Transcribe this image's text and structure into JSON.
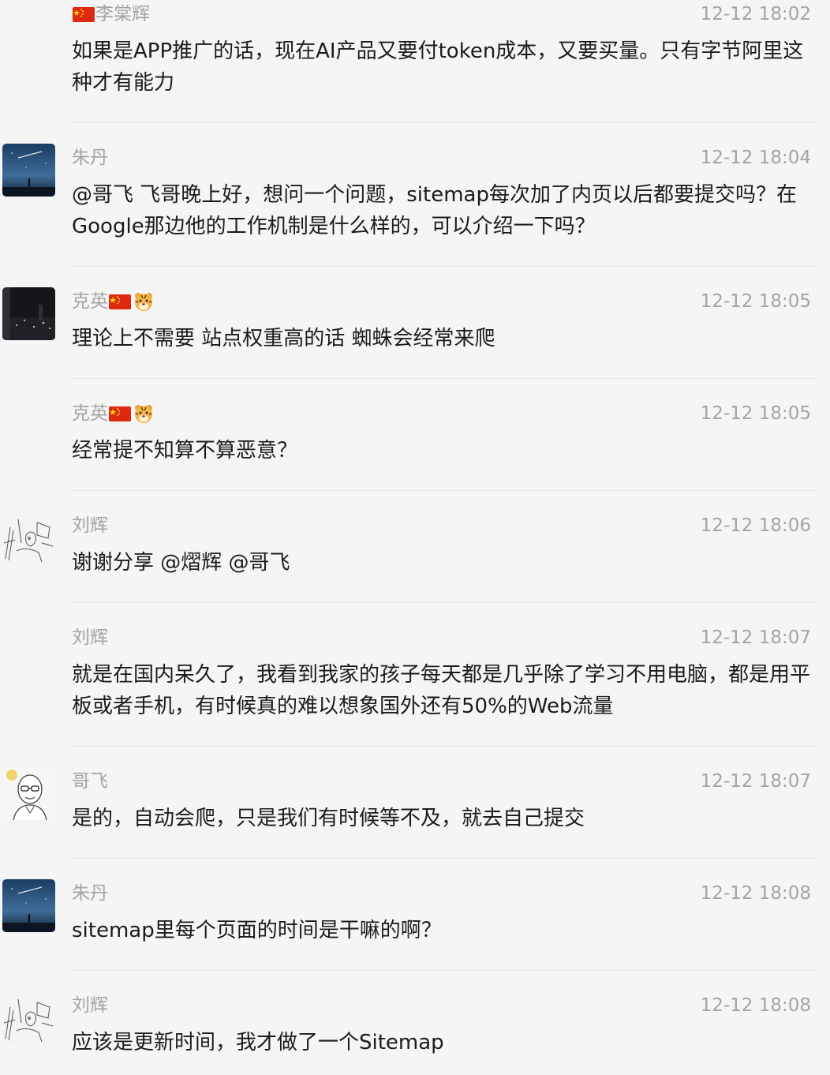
{
  "messages": [
    {
      "sender": "李棠辉",
      "time": "12-12 18:02",
      "text": "如果是APP推广的话，现在AI产品又要付token成本，又要买量。只有字节阿里这种才有能力"
    },
    {
      "sender": "朱丹",
      "time": "12-12 18:04",
      "text": "@哥飞 飞哥晚上好，想问一个问题，sitemap每次加了内页以后都要提交吗？在Google那边他的工作机制是什么样的，可以介绍一下吗？"
    },
    {
      "sender": "克英",
      "time": "12-12 18:05",
      "text": "理论上不需要  站点权重高的话 蜘蛛会经常来爬"
    },
    {
      "sender": "克英",
      "time": "12-12 18:05",
      "text": "经常提不知算不算恶意？"
    },
    {
      "sender": "刘辉",
      "time": "12-12 18:06",
      "text": "谢谢分享 @熠辉 @哥飞"
    },
    {
      "sender": "刘辉",
      "time": "12-12 18:07",
      "text": "就是在国内呆久了，我看到我家的孩子每天都是几乎除了学习不用电脑，都是用平板或者手机，有时候真的难以想象国外还有50%的Web流量"
    },
    {
      "sender": "哥飞",
      "time": "12-12 18:07",
      "text": "是的，自动会爬，只是我们有时候等不及，就去自己提交"
    },
    {
      "sender": "朱丹",
      "time": "12-12 18:08",
      "text": "sitemap里每个页面的时间是干嘛的啊？"
    },
    {
      "sender": "刘辉",
      "time": "12-12 18:08",
      "text": "应该是更新时间，我才做了一个Sitemap"
    }
  ],
  "icons": {
    "flag": "china-flag-icon",
    "tiger": "tiger-face-icon"
  },
  "colors": {
    "background": "#f5f5f5",
    "meta_text": "#a4a4a4",
    "body_text": "#1b1b1b",
    "divider": "#e4e4e4"
  }
}
